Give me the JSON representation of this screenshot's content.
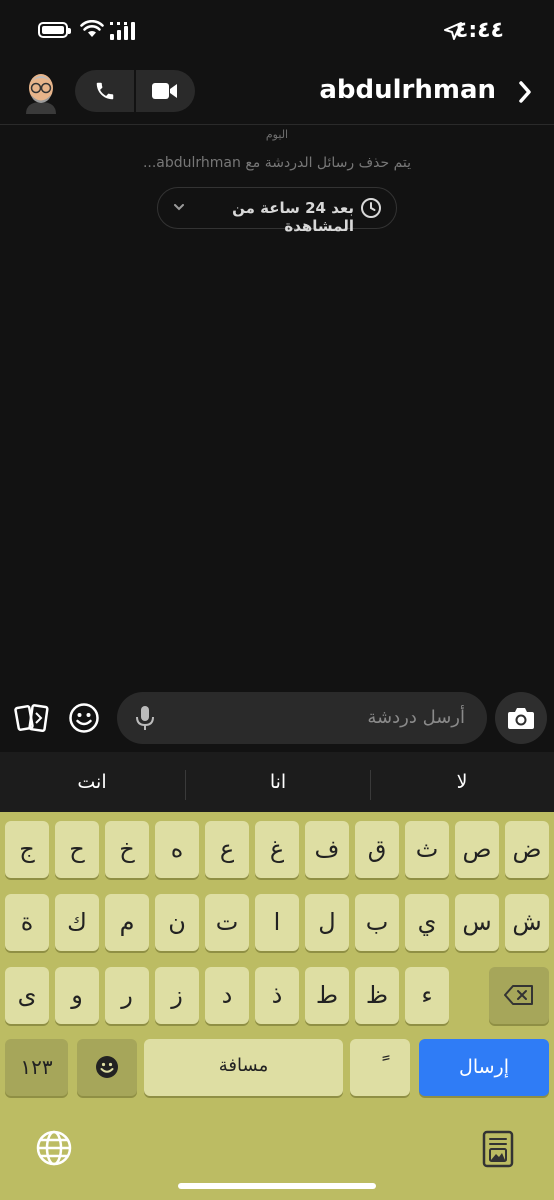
{
  "status_bar": {
    "time": "٤:٤٤"
  },
  "header": {
    "username": "abdulrhman"
  },
  "chat": {
    "date_label": "اليوم",
    "info_text": "يتم حذف رسائل الدردشة مع abdulrhman...",
    "timer_label": "بعد 24 ساعة من المشاهدة"
  },
  "input": {
    "placeholder": "أرسل دردشة"
  },
  "suggestions": [
    "لا",
    "انا",
    "انت"
  ],
  "keyboard": {
    "row1": [
      "ض",
      "ص",
      "ث",
      "ق",
      "ف",
      "غ",
      "ع",
      "ه",
      "خ",
      "ح",
      "ج"
    ],
    "row2": [
      "ش",
      "س",
      "ي",
      "ب",
      "ل",
      "ا",
      "ت",
      "ن",
      "م",
      "ك",
      "ة"
    ],
    "row3": [
      "ء",
      "ظ",
      "ط",
      "ذ",
      "د",
      "ز",
      "ر",
      "و",
      "ى"
    ],
    "numbers_label": "١٢٣",
    "space_label": "مسافة",
    "diacritic_label": "ً",
    "send_label": "إرسال"
  },
  "colors": {
    "background": "#121212",
    "keyboard": "#bcbc63",
    "key": "#dedea3",
    "send": "#2f7cf6"
  }
}
